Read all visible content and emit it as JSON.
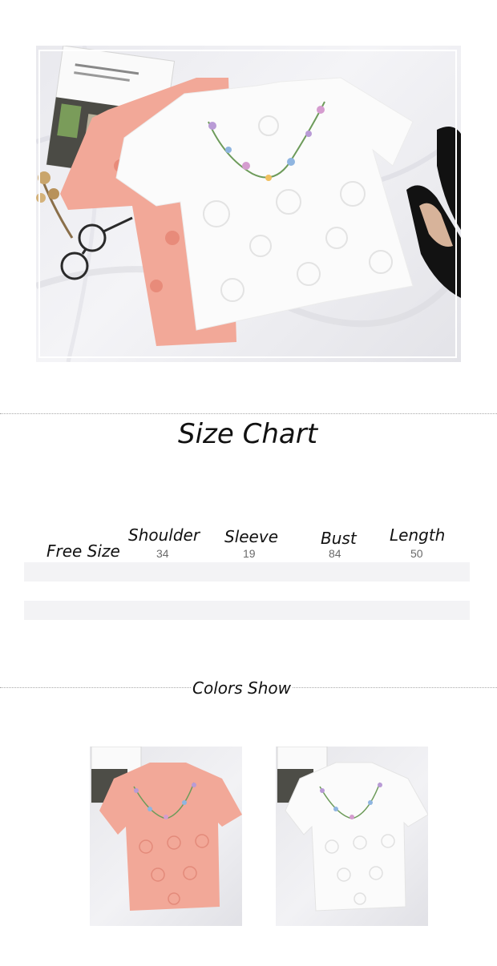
{
  "sections": {
    "size_chart_title": "Size Chart",
    "colors_title": "Colors Show"
  },
  "size_table": {
    "row_label": "Free Size",
    "columns": [
      {
        "header": "Shoulder",
        "value": "34"
      },
      {
        "header": "Sleeve",
        "value": "19"
      },
      {
        "header": "Bust",
        "value": "84"
      },
      {
        "header": "Length",
        "value": "50"
      }
    ]
  },
  "colors": {
    "background": "#ffffff",
    "pink_top": "#f2a898",
    "white_top": "#fbfbfb",
    "fabric": "#ebebef",
    "stripe": "#f3f3f5"
  }
}
